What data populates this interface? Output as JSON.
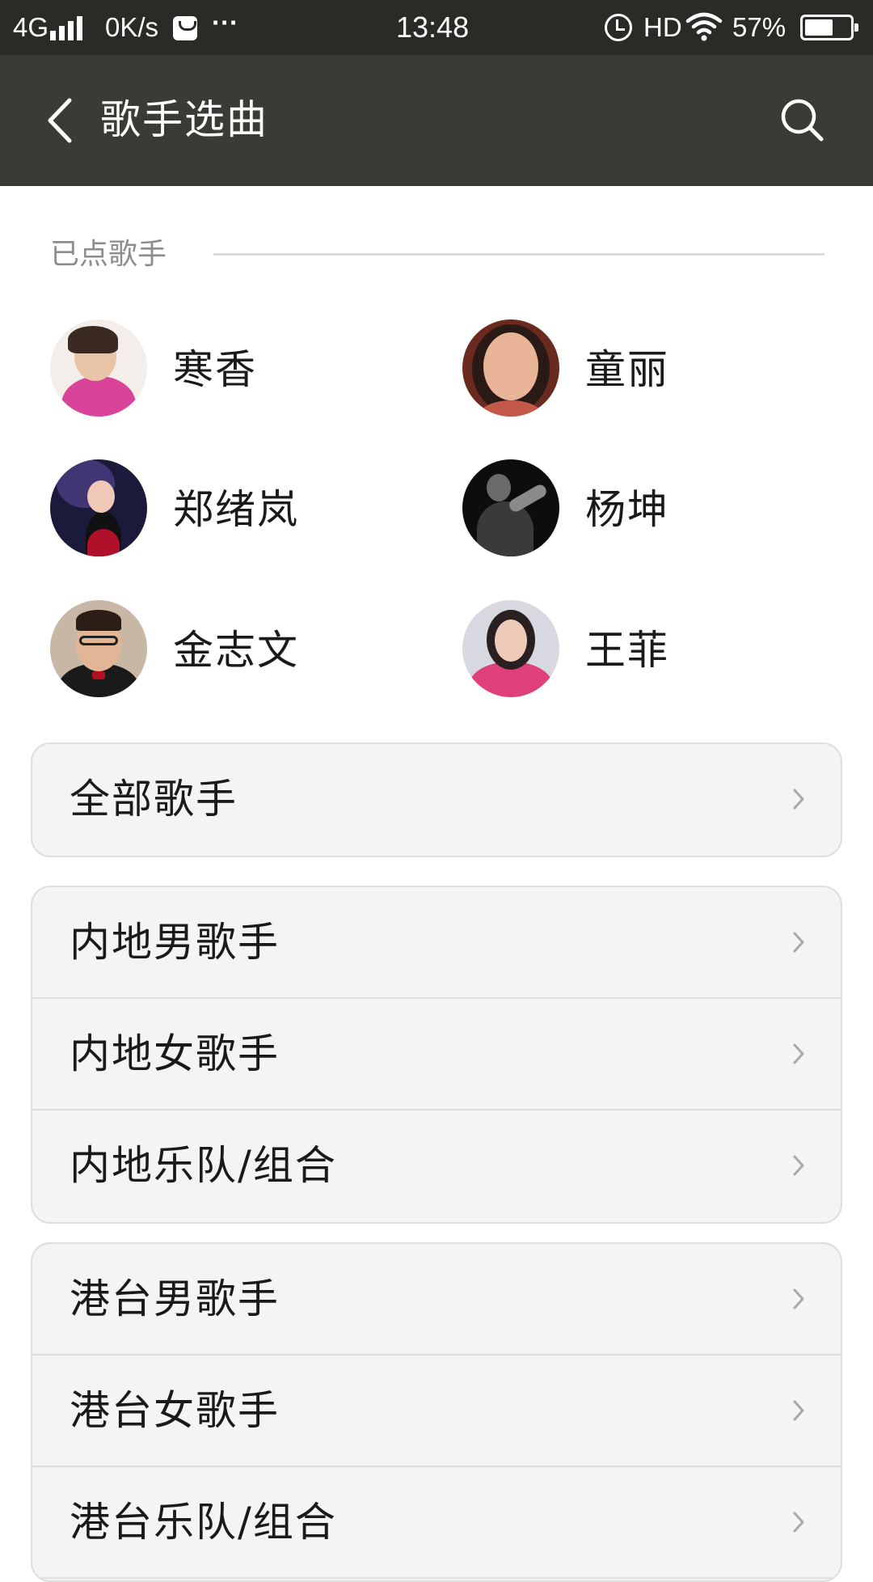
{
  "status_bar": {
    "network": "4G",
    "speed": "0K/s",
    "more": "···",
    "time": "13:48",
    "hd": "HD",
    "battery": "57%"
  },
  "header": {
    "title": "歌手选曲",
    "back_icon": "chevron-left-icon",
    "search_icon": "search-icon"
  },
  "recent_section": {
    "label": "已点歌手",
    "singers": [
      {
        "name": "寒香"
      },
      {
        "name": "童丽"
      },
      {
        "name": "郑绪岚"
      },
      {
        "name": "杨坤"
      },
      {
        "name": "金志文"
      },
      {
        "name": "王菲"
      }
    ]
  },
  "menu_groups": [
    {
      "items": [
        {
          "label": "全部歌手"
        }
      ]
    },
    {
      "items": [
        {
          "label": "内地男歌手"
        },
        {
          "label": "内地女歌手"
        },
        {
          "label": "内地乐队/组合"
        }
      ]
    },
    {
      "items": [
        {
          "label": "港台男歌手"
        },
        {
          "label": "港台女歌手"
        },
        {
          "label": "港台乐队/组合"
        }
      ]
    }
  ],
  "colors": {
    "header_bg": "#3b3a35",
    "status_bg": "#2b2a27",
    "menu_bg": "#f5f4f3",
    "divider": "#dfdedc"
  }
}
